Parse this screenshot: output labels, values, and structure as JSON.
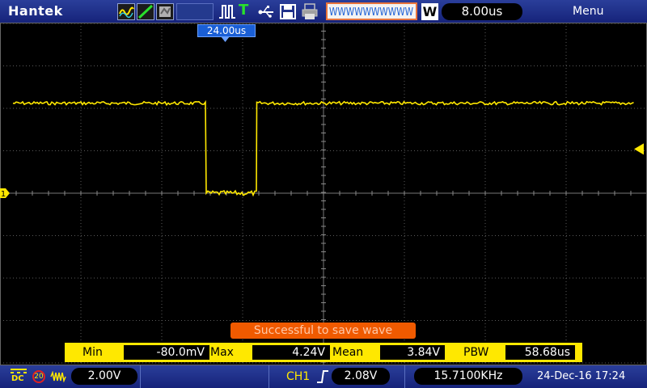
{
  "header": {
    "brand": "Hantek",
    "wave_display": "WWWWWWWWWW",
    "timebase_mode": "W",
    "timebase": "8.00us",
    "menu_label": "Menu"
  },
  "trigger": {
    "position_label": "24.00us",
    "channel_marker": "1"
  },
  "status": {
    "toast": "Successful to save wave"
  },
  "measurements": {
    "min_label": "Min",
    "min_value": "-80.0mV",
    "max_label": "Max",
    "max_value": "4.24V",
    "mean_label": "Mean",
    "mean_value": "3.84V",
    "pbw_label": "PBW",
    "pbw_value": "58.68us"
  },
  "bottom": {
    "coupling": "DC",
    "bw_limit": "20",
    "ch1_scale": "2.00V",
    "trigger_source": "CH1",
    "trigger_level": "2.08V",
    "frequency": "15.7100KHz",
    "datetime": "24-Dec-16 17:24"
  },
  "colors": {
    "trace": "#ffe800",
    "grid": "#5a5a5a",
    "header_bg": "#1e2f8a",
    "toast_bg": "#f05a00",
    "trigger_label_bg": "#1a5fd6"
  },
  "waveform": {
    "high_level_v": 4.24,
    "low_level_v": -0.08,
    "timebase_us_per_div": 8.0,
    "ch1_volts_per_div": 2.0,
    "trigger_level_v": 2.08,
    "frequency_khz": 15.71,
    "low_pulse_width_us": 5.0
  }
}
